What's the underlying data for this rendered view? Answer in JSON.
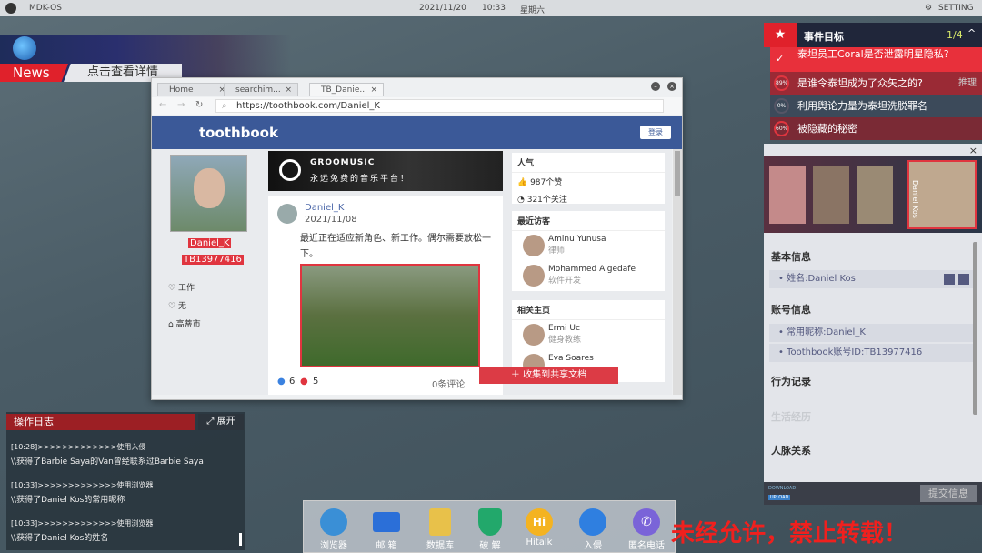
{
  "os": {
    "name": "MDK-OS",
    "date": "2021/11/20",
    "time": "10:33",
    "weekday": "星期六",
    "setting": "SETTING"
  },
  "news": {
    "label": "News",
    "detail": "点击查看详情"
  },
  "browser": {
    "tabs": [
      {
        "label": "Home"
      },
      {
        "label": "searchim..."
      },
      {
        "label": "TB_Danie..."
      }
    ],
    "url": "https://toothbook.com/Daniel_K"
  },
  "toothbook": {
    "logo": "toothbook",
    "login": "登录",
    "profile": {
      "name": "Daniel_K",
      "id": "TB13977416",
      "work": "工作",
      "relationship": "无",
      "city": "高蒂市"
    },
    "ad": {
      "brand": "GROOMUSIC",
      "slogan": "永远免费的音乐平台！"
    },
    "post": {
      "author": "Daniel_K",
      "date": "2021/11/08",
      "text": "最近正在适应新角色、新工作。偶尔需要放松一下。",
      "likes": "6",
      "hearts": "5",
      "comments": "0条评论"
    },
    "popularity": {
      "title": "人气",
      "likes": "987个赞",
      "follows": "321个关注"
    },
    "visitors": {
      "title": "最近访客",
      "people": [
        {
          "name": "Aminu Yunusa",
          "job": "律师"
        },
        {
          "name": "Mohammed Algedafe",
          "job": "软件开发"
        }
      ]
    },
    "related": {
      "title": "相关主页",
      "people": [
        {
          "name": "Ermi Uc",
          "job": "健身教练"
        },
        {
          "name": "Eva Soares",
          "job": ""
        }
      ]
    },
    "collect": "收集到共享文档"
  },
  "events": {
    "title": "事件目标",
    "progress": "1/4",
    "items": [
      {
        "text": "泰坦员工Coral是否泄露明星隐私?",
        "pct": "done"
      },
      {
        "text": "是谁令泰坦成为了众矢之的?",
        "pct": "89%",
        "action": "推理"
      },
      {
        "text": "利用舆论力量为泰坦洗脱罪名",
        "pct": "0%"
      },
      {
        "text": "被隐藏的秘密",
        "pct": "60%"
      }
    ]
  },
  "dossier": {
    "portrait_name": "Daniel Kos",
    "basic_title": "基本信息",
    "name_item": "姓名:Daniel Kos",
    "account_title": "账号信息",
    "nickname": "常用昵称:Daniel_K",
    "tb_id": "Toothbook账号ID:TB13977416",
    "behavior_title": "行为记录",
    "life_title": "生活经历",
    "relations_title": "人脉关系",
    "download": "DOWNLOAD",
    "upload": "UPLOAD",
    "submit": "提交信息"
  },
  "log": {
    "title": "操作日志",
    "expand": "展开",
    "lines": [
      "[10:28]>>>>>>>>>>>>>使用入侵",
      "\\\\获得了Barbie Saya的Van曾经联系过Barbie Saya",
      "[10:33]>>>>>>>>>>>>>使用浏览器",
      "\\\\获得了Daniel Kos的常用昵称",
      "[10:33]>>>>>>>>>>>>>使用浏览器",
      "\\\\获得了Daniel Kos的姓名"
    ]
  },
  "dock": [
    {
      "label": "浏览器",
      "color": "#3a8fd6"
    },
    {
      "label": "邮 箱",
      "color": "#2b6fd8"
    },
    {
      "label": "数据库",
      "color": "#e8c14a"
    },
    {
      "label": "破 解",
      "color": "#22a86b"
    },
    {
      "label": "Hitalk",
      "color": "#f4b321"
    },
    {
      "label": "入侵",
      "color": "#2f7fe0"
    },
    {
      "label": "匿名电话",
      "color": "#7a64d8"
    }
  ],
  "warning": "未经允许，禁止转载！"
}
